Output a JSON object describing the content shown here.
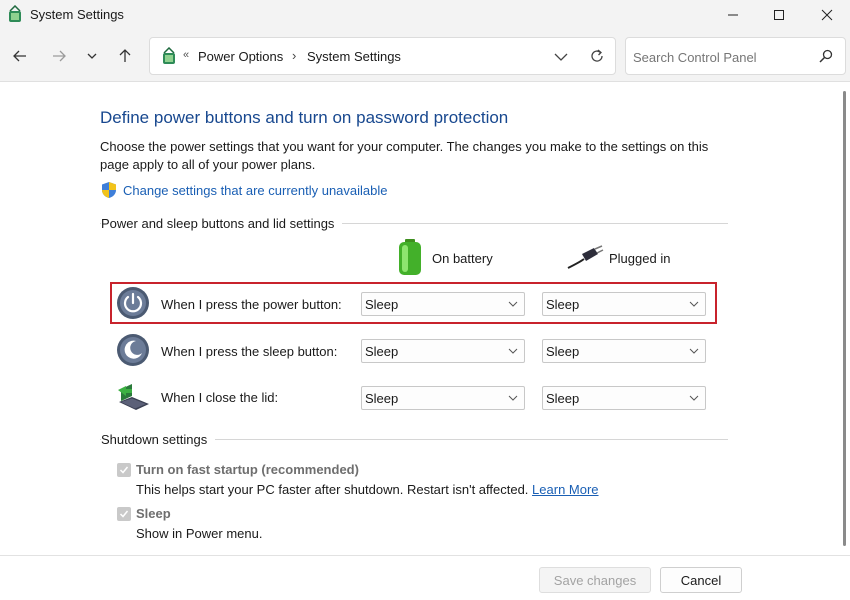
{
  "window": {
    "title": "System Settings"
  },
  "nav": {
    "breadcrumbs": [
      "Power Options",
      "System Settings"
    ],
    "search_placeholder": "Search Control Panel"
  },
  "main": {
    "heading": "Define power buttons and turn on password protection",
    "description": "Choose the power settings that you want for your computer. The changes you make to the settings on this page apply to all of your power plans.",
    "change_link": "Change settings that are currently unavailable",
    "buttons_group_label": "Power and sleep buttons and lid settings",
    "column_on_battery": "On battery",
    "column_plugged_in": "Plugged in",
    "rows": [
      {
        "label": "When I press the power button:",
        "on_battery": "Sleep",
        "plugged_in": "Sleep"
      },
      {
        "label": "When I press the sleep button:",
        "on_battery": "Sleep",
        "plugged_in": "Sleep"
      },
      {
        "label": "When I close the lid:",
        "on_battery": "Sleep",
        "plugged_in": "Sleep"
      }
    ],
    "shutdown_group_label": "Shutdown settings",
    "fast_startup_title": "Turn on fast startup (recommended)",
    "fast_startup_desc": "This helps start your PC faster after shutdown. Restart isn't affected.",
    "learn_more": "Learn More",
    "sleep_title": "Sleep",
    "sleep_desc": "Show in Power menu."
  },
  "footer": {
    "save_label": "Save changes",
    "cancel_label": "Cancel"
  },
  "colors": {
    "heading": "#18488f",
    "link": "#1a5fb4",
    "highlight": "#c8232c"
  }
}
